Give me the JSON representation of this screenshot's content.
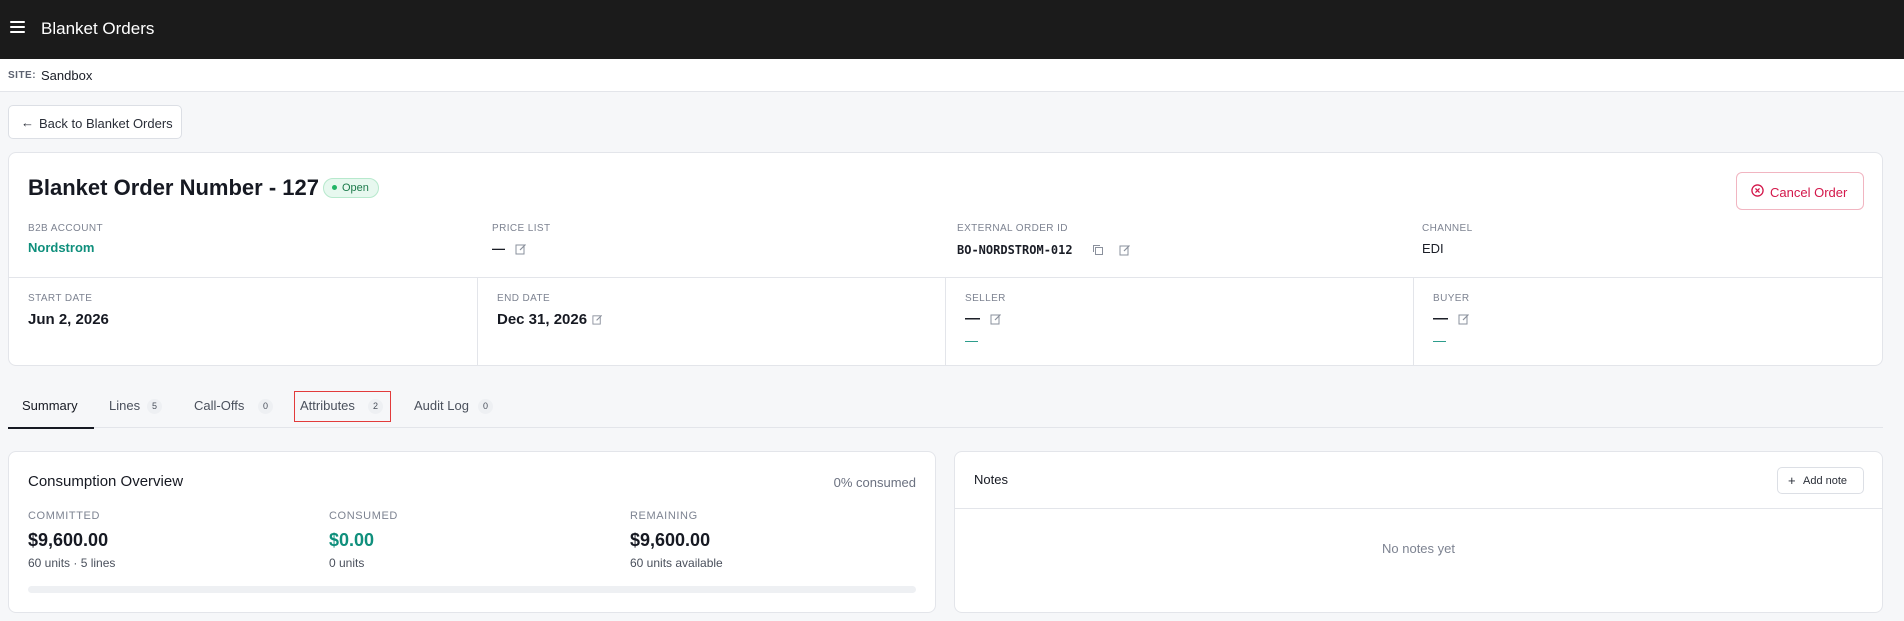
{
  "app": {
    "title": "Blanket Orders"
  },
  "site": {
    "label": "SITE:",
    "value": "Sandbox"
  },
  "back_button": {
    "label": "Back to Blanket Orders"
  },
  "order": {
    "title": "Blanket Order Number - 127",
    "status": "Open",
    "cancel_label": "Cancel Order",
    "fields": {
      "b2b_account": {
        "label": "B2B ACCOUNT",
        "value": "Nordstrom"
      },
      "price_list": {
        "label": "PRICE LIST",
        "value": "—"
      },
      "external_order_id": {
        "label": "EXTERNAL ORDER ID",
        "value": "BO-NORDSTROM-012"
      },
      "channel": {
        "label": "CHANNEL",
        "value": "EDI"
      },
      "start_date": {
        "label": "START DATE",
        "value": "Jun 2, 2026"
      },
      "end_date": {
        "label": "END DATE",
        "value": "Dec 31, 2026"
      },
      "seller": {
        "label": "SELLER",
        "value": "—",
        "sub": "—"
      },
      "buyer": {
        "label": "BUYER",
        "value": "—",
        "sub": "—"
      }
    }
  },
  "tabs": [
    {
      "label": "Summary",
      "count": null,
      "active": true
    },
    {
      "label": "Lines",
      "count": "5"
    },
    {
      "label": "Call-Offs",
      "count": "0"
    },
    {
      "label": "Attributes",
      "count": "2"
    },
    {
      "label": "Audit Log",
      "count": "0"
    }
  ],
  "consumption": {
    "title": "Consumption Overview",
    "percent_text": "0% consumed",
    "progress_fraction": 0,
    "committed": {
      "label": "COMMITTED",
      "value": "$9,600.00",
      "sub": "60 units · 5 lines"
    },
    "consumed": {
      "label": "CONSUMED",
      "value": "$0.00",
      "sub": "0 units"
    },
    "remaining": {
      "label": "REMAINING",
      "value": "$9,600.00",
      "sub": "60 units available"
    }
  },
  "notes": {
    "title": "Notes",
    "add_label": "Add note",
    "empty": "No notes yet"
  },
  "colors": {
    "accent_teal": "#0f8f7c",
    "danger": "#d3174a",
    "topbar": "#1b1b1b"
  }
}
